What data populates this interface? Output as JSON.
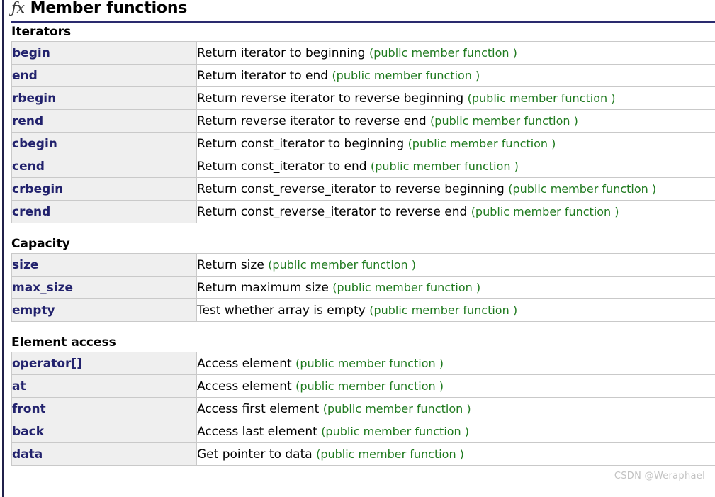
{
  "page": {
    "icon": "fx-icon",
    "title": "Member functions",
    "watermark": "CSDN @Weraphael",
    "kind_label": "(public member function )",
    "colors": {
      "name_text": "#22226d",
      "kind_text": "#1f7a1f",
      "name_cell_bg": "#efefef",
      "row_border": "#c9c9c9",
      "title_rule": "#2a2a6e",
      "left_rule": "#20204a",
      "watermark": "#c2c2c2"
    }
  },
  "sections": [
    {
      "heading": "Iterators",
      "rows": [
        {
          "name": "begin",
          "desc": "Return iterator to beginning",
          "kind": "(public member function )"
        },
        {
          "name": "end",
          "desc": "Return iterator to end",
          "kind": "(public member function )"
        },
        {
          "name": "rbegin",
          "desc": "Return reverse iterator to reverse beginning",
          "kind": "(public member function )"
        },
        {
          "name": "rend",
          "desc": "Return reverse iterator to reverse end",
          "kind": "(public member function )"
        },
        {
          "name": "cbegin",
          "desc": "Return const_iterator to beginning",
          "kind": "(public member function )"
        },
        {
          "name": "cend",
          "desc": "Return const_iterator to end",
          "kind": "(public member function )"
        },
        {
          "name": "crbegin",
          "desc": "Return const_reverse_iterator to reverse beginning",
          "kind": "(public member function )"
        },
        {
          "name": "crend",
          "desc": "Return const_reverse_iterator to reverse end",
          "kind": "(public member function )"
        }
      ]
    },
    {
      "heading": "Capacity",
      "rows": [
        {
          "name": "size",
          "desc": "Return size",
          "kind": "(public member function )"
        },
        {
          "name": "max_size",
          "desc": "Return maximum size",
          "kind": "(public member function )"
        },
        {
          "name": "empty",
          "desc": "Test whether array is empty",
          "kind": "(public member function )"
        }
      ]
    },
    {
      "heading": "Element access",
      "rows": [
        {
          "name": "operator[]",
          "desc": "Access element",
          "kind": "(public member function )"
        },
        {
          "name": "at",
          "desc": "Access element",
          "kind": "(public member function )"
        },
        {
          "name": "front",
          "desc": "Access first element",
          "kind": "(public member function )"
        },
        {
          "name": "back",
          "desc": "Access last element",
          "kind": "(public member function )"
        },
        {
          "name": "data",
          "desc": "Get pointer to data",
          "kind": "(public member function )"
        }
      ]
    }
  ]
}
